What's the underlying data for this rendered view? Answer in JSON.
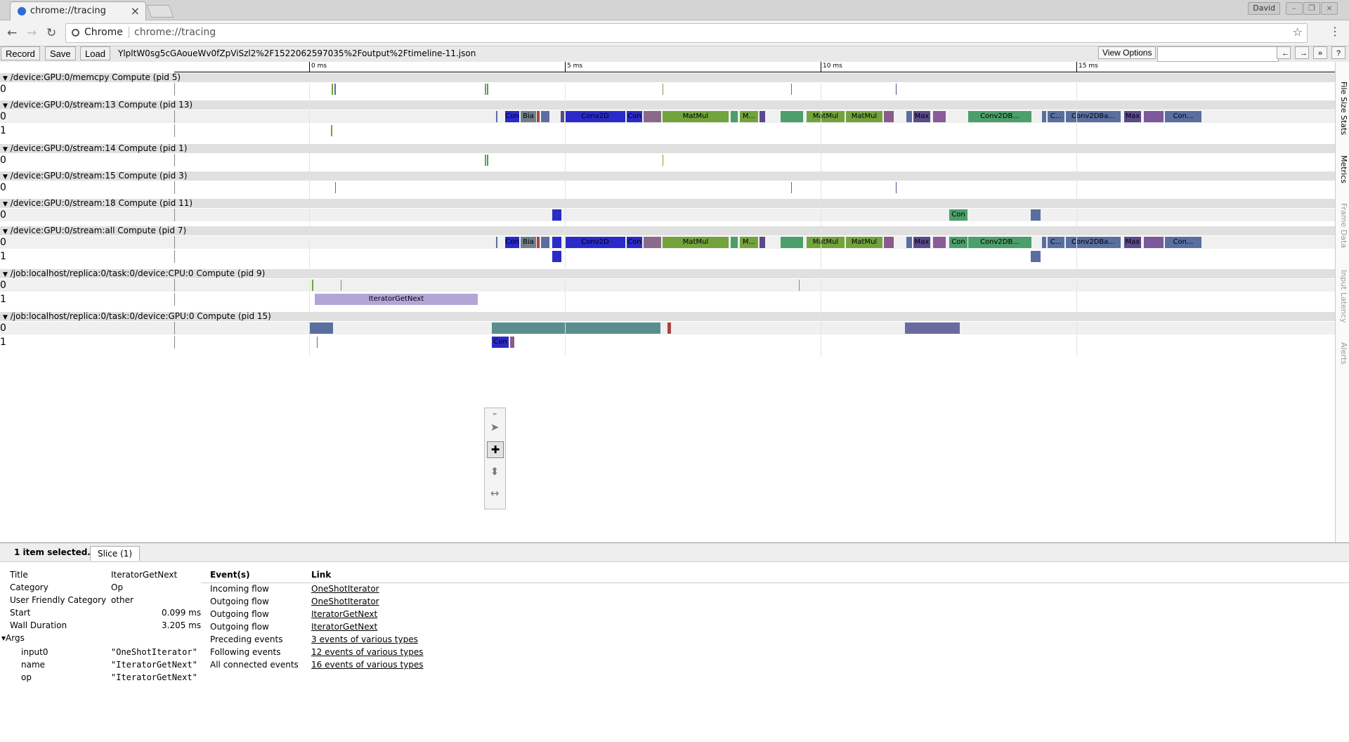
{
  "browser": {
    "tab_title": "chrome://tracing",
    "user": "David",
    "origin": "Chrome",
    "url": "chrome://tracing"
  },
  "toolbar": {
    "record": "Record",
    "save": "Save",
    "load": "Load",
    "filename": "YlpltW0sg5cGAoueWv0fZpViSzl2%2F1522062597035%2Foutput%2Ftimeline-11.json",
    "view_options": "View Options",
    "nav_prev": "←",
    "nav_next": "→",
    "nav_more": "»",
    "help": "?"
  },
  "ruler": {
    "ticks": [
      "0 ms",
      "5 ms",
      "10 ms",
      "15 ms"
    ]
  },
  "tracks": [
    {
      "title": "/device:GPU:0/memcpy Compute (pid 5)",
      "lanes": [
        "0"
      ]
    },
    {
      "title": "/device:GPU:0/stream:13 Compute (pid 13)",
      "lanes": [
        "0",
        "1"
      ]
    },
    {
      "title": "/device:GPU:0/stream:14 Compute (pid 1)",
      "lanes": [
        "0"
      ]
    },
    {
      "title": "/device:GPU:0/stream:15 Compute (pid 3)",
      "lanes": [
        "0"
      ]
    },
    {
      "title": "/device:GPU:0/stream:18 Compute (pid 11)",
      "lanes": [
        "0"
      ]
    },
    {
      "title": "/device:GPU:0/stream:all Compute (pid 7)",
      "lanes": [
        "0",
        "1"
      ]
    },
    {
      "title": "/job:localhost/replica:0/task:0/device:CPU:0 Compute (pid 9)",
      "lanes": [
        "0",
        "1"
      ]
    },
    {
      "title": "/job:localhost/replica:0/task:0/device:GPU:0 Compute (pid 15)",
      "lanes": [
        "0",
        "1"
      ]
    }
  ],
  "slice_labels": {
    "con": "Con",
    "bia": "Bia",
    "conv2d": "Conv2D",
    "matmul": "MatMul",
    "m_ellipsis": "M...",
    "max": "Max",
    "conv2db": "Conv2DB...",
    "c_ellipsis": "C...",
    "conv2dba": "Conv2DBa...",
    "con_ellipsis": "Con...",
    "iterator": "IteratorGetNext"
  },
  "side_tabs": [
    "File Size Stats",
    "Metrics",
    "Frame Data",
    "Input Latency",
    "Alerts"
  ],
  "colors": {
    "conv": "#2a2ac8",
    "matmul": "#73a33c",
    "bias": "#6f7f8c",
    "green": "#4c9e6a",
    "max": "#5a4a8a",
    "backprop": "#5a6fa0",
    "iterator": "#b3a6d6"
  },
  "bottom": {
    "selected": "1 item selected.",
    "tab": "Slice (1)",
    "props": [
      {
        "k": "Title",
        "v": "IteratorGetNext"
      },
      {
        "k": "Category",
        "v": "Op"
      },
      {
        "k": "User Friendly Category",
        "v": "other"
      },
      {
        "k": "Start",
        "v": "0.099 ms"
      },
      {
        "k": "Wall Duration",
        "v": "3.205 ms"
      }
    ],
    "args_label": "▾Args",
    "args": [
      {
        "k": "input0",
        "v": "\"OneShotIterator\""
      },
      {
        "k": "name",
        "v": "\"IteratorGetNext\""
      },
      {
        "k": "op",
        "v": "\"IteratorGetNext\""
      }
    ],
    "events_header": "Event(s)",
    "link_header": "Link",
    "events": [
      {
        "k": "Incoming flow",
        "v": "OneShotIterator"
      },
      {
        "k": "Outgoing flow",
        "v": "OneShotIterator"
      },
      {
        "k": "Outgoing flow",
        "v": "IteratorGetNext"
      },
      {
        "k": "Outgoing flow",
        "v": "IteratorGetNext"
      },
      {
        "k": "Preceding events",
        "v": "3 events of various types"
      },
      {
        "k": "Following events",
        "v": "12 events of various types"
      },
      {
        "k": "All connected events",
        "v": "16 events of various types"
      }
    ]
  }
}
